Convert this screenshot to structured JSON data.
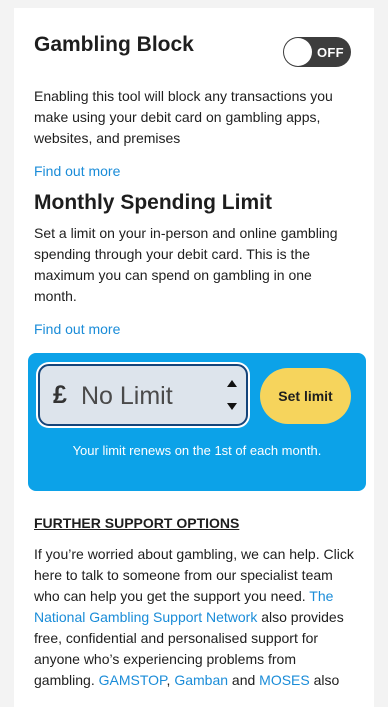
{
  "gambling_block": {
    "title": "Gambling Block",
    "toggle_label": "OFF",
    "toggle_state": "off",
    "description": "Enabling this tool will block any transactions you make using your debit card on gambling apps, websites, and premises",
    "find_out_more": "Find out more"
  },
  "monthly_limit": {
    "title": "Monthly Spending Limit",
    "description": "Set a limit on your in-person and online gambling spending through your debit card. This is the maximum you can spend on gambling in one month.",
    "find_out_more": "Find out more",
    "currency_symbol": "£",
    "input_placeholder": "No Limit",
    "input_value": "",
    "set_limit_label": "Set limit",
    "renew_note": "Your limit renews on the 1st of each month."
  },
  "further_support": {
    "title": "FURTHER SUPPORT OPTIONS",
    "text_1": "If you’re worried about gambling, we can help. Click here to talk to someone from our specialist team who can help you get the support you need. ",
    "link_1": "The National Gambling Support Network",
    "text_2": " also provides free, confidential and personalised support for anyone who’s experiencing problems from gambling. ",
    "link_2": "GAMSTOP",
    "sep_1": ", ",
    "link_3": "Gamban",
    "sep_2": " and ",
    "link_4": "MOSES",
    "text_3": " also"
  },
  "colors": {
    "page_background": "#f3f3f3",
    "link": "#1a8cd8",
    "limit_panel": "#0ca2e8",
    "set_limit_button": "#f6d45c",
    "toggle_off": "#3d3d3d",
    "input_border": "#14447a"
  }
}
